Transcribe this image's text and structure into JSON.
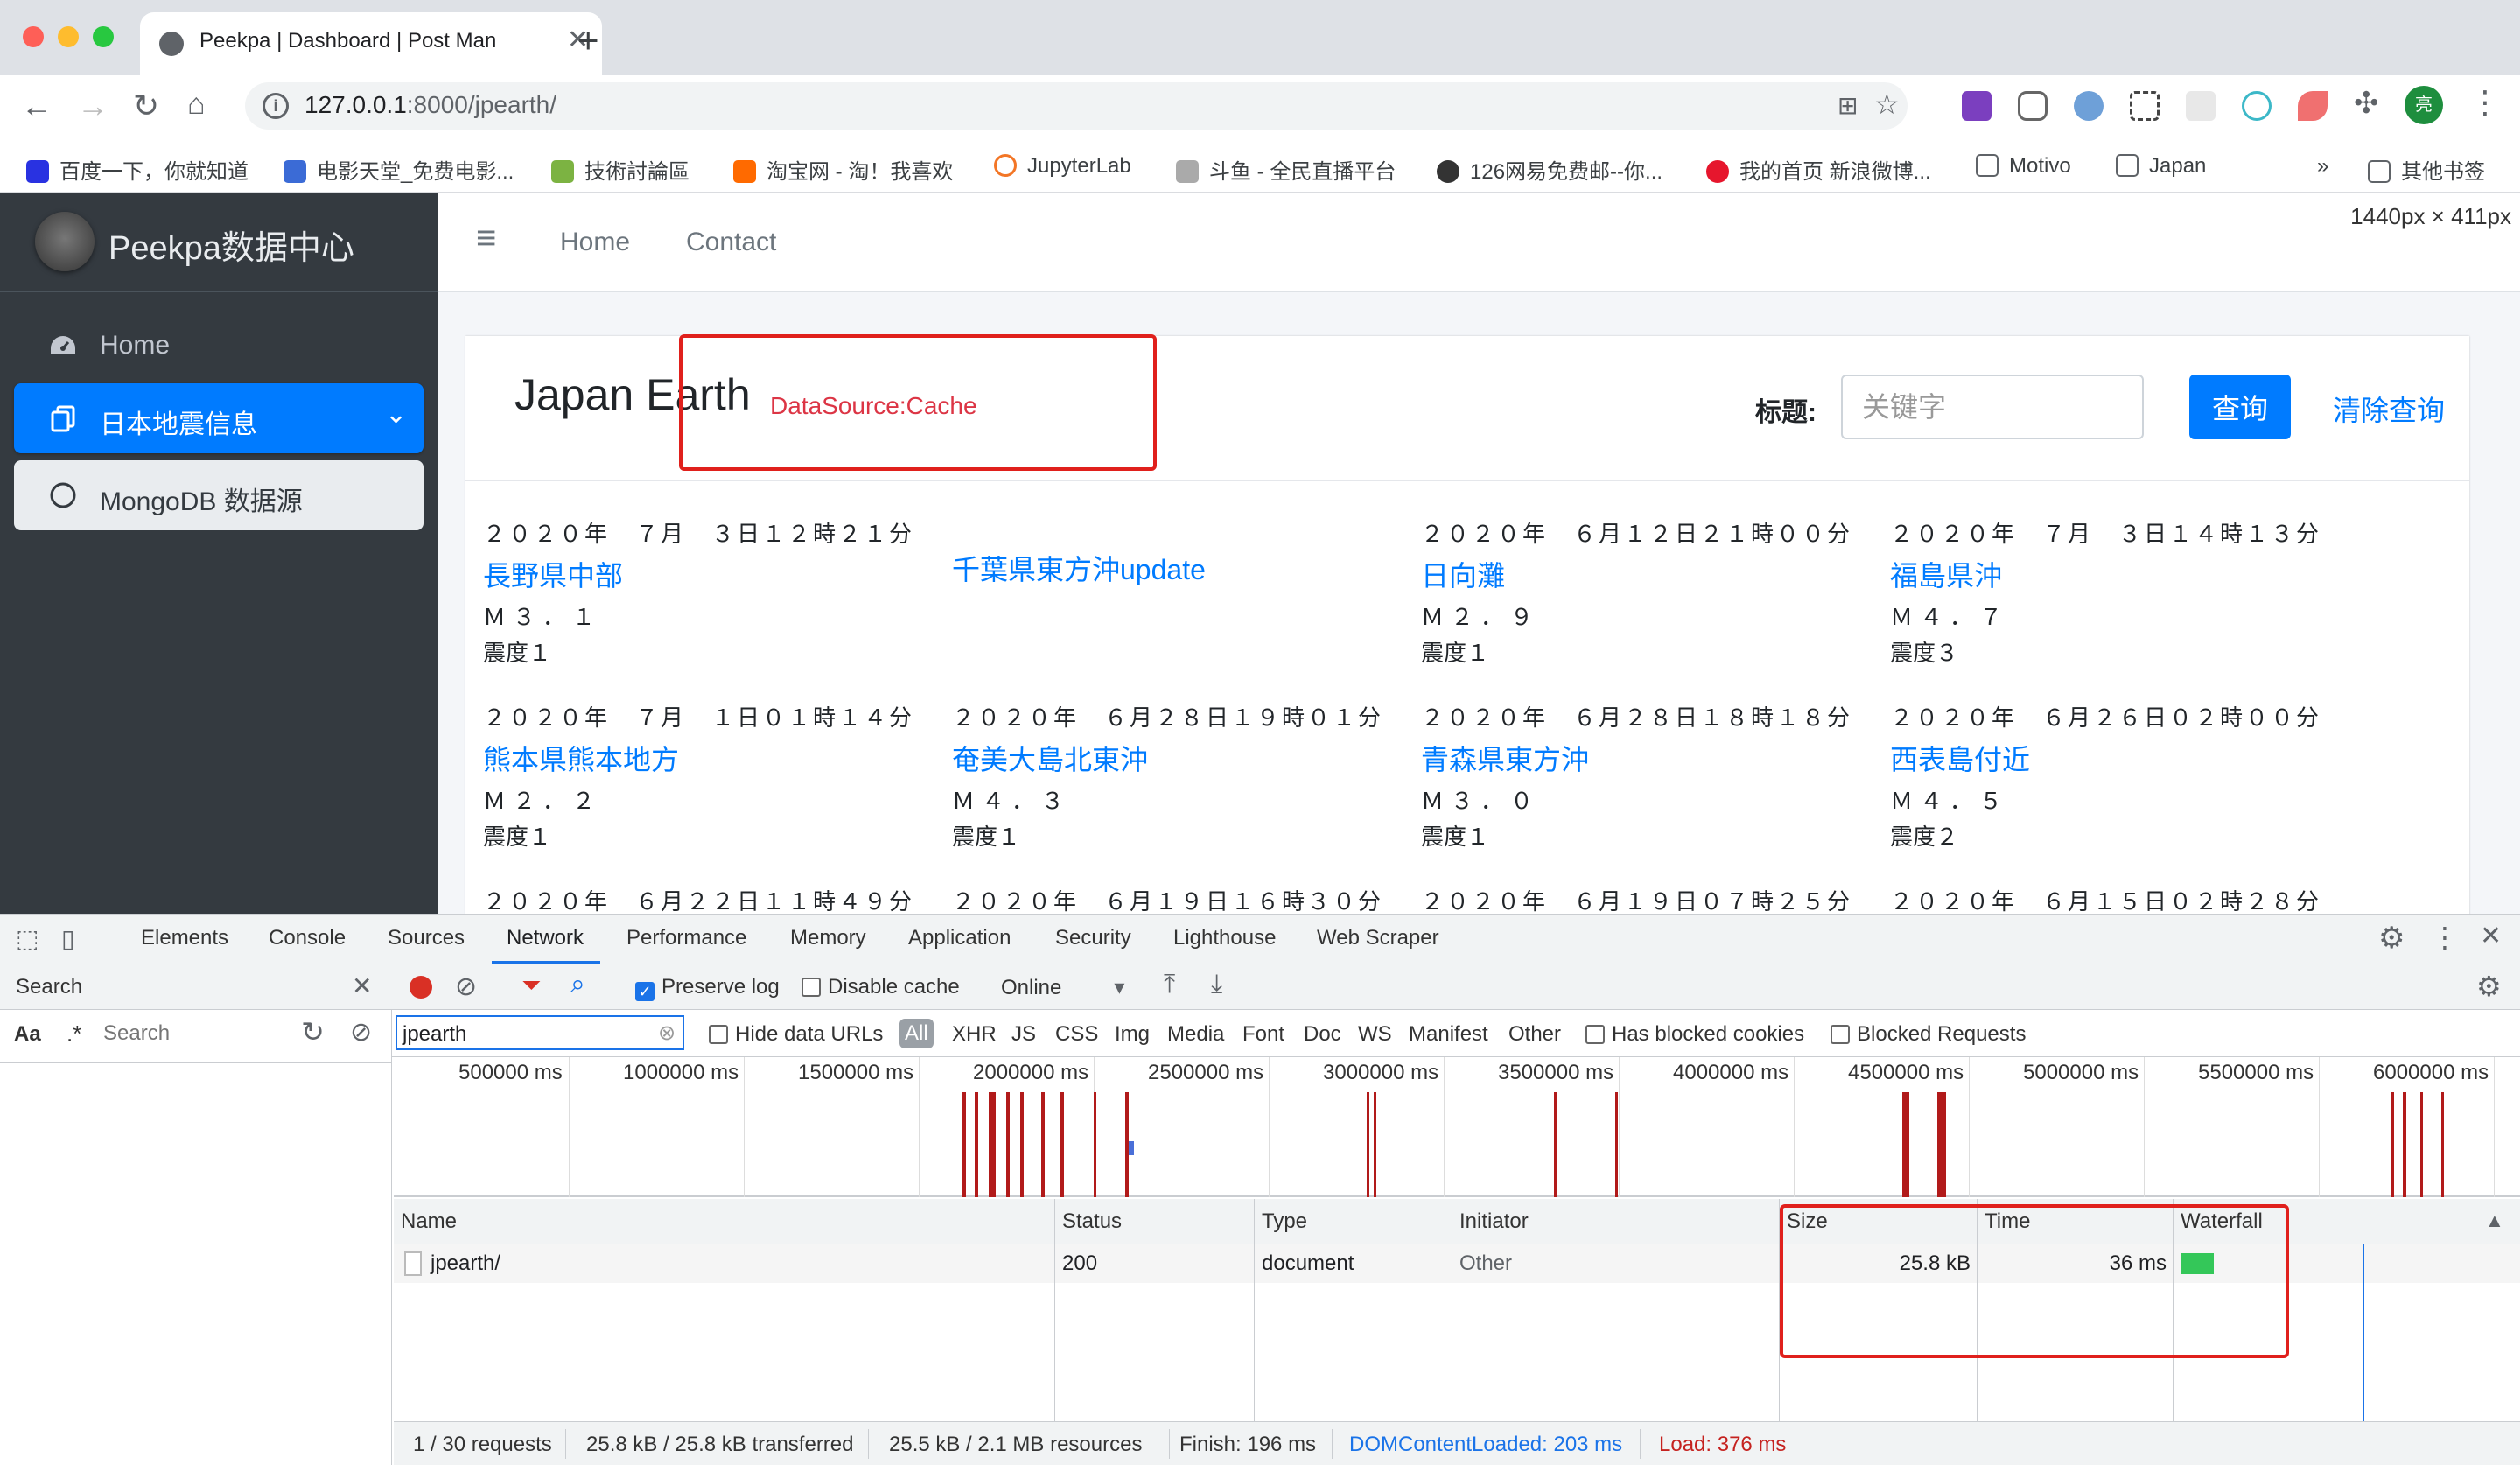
{
  "browser": {
    "tab_title": "Peekpa | Dashboard | Post Man",
    "url_host": "127.0.0.1",
    "url_rest": ":8000/jpearth/",
    "bookmarks": [
      "百度一下，你就知道",
      "电影天堂_免费电影...",
      "技術討論區",
      "淘宝网 - 淘！我喜欢",
      "JupyterLab",
      "斗鱼 - 全民直播平台",
      "126网易免费邮--你...",
      "我的首页 新浪微博...",
      "Motivo",
      "Japan",
      "»",
      "其他书签"
    ]
  },
  "sidebar": {
    "brand": "Peekpa数据中心",
    "items": [
      {
        "label": "Home"
      },
      {
        "label": "日本地震信息"
      },
      {
        "label": "MongoDB 数据源"
      }
    ]
  },
  "topnav": {
    "home": "Home",
    "contact": "Contact",
    "dims": "1440px × 411px"
  },
  "card": {
    "title": "Japan Earth",
    "datasource": "DataSource:Cache",
    "filter_label": "标题:",
    "filter_placeholder": "关键字",
    "search_btn": "查询",
    "clear_link": "清除查询"
  },
  "quakes": [
    {
      "time": "２０２０年　７月　３日１２時２１分",
      "loc": "長野県中部",
      "mag": "Ｍ３．１",
      "shindo": "震度１"
    },
    {
      "time": "",
      "loc": "千葉県東方沖update",
      "mag": "",
      "shindo": ""
    },
    {
      "time": "２０２０年　６月１２日２１時００分",
      "loc": "日向灘",
      "mag": "Ｍ２．９",
      "shindo": "震度１"
    },
    {
      "time": "２０２０年　７月　３日１４時１３分",
      "loc": "福島県沖",
      "mag": "Ｍ４．７",
      "shindo": "震度３"
    },
    {
      "time": "２０２０年　７月　１日０１時１４分",
      "loc": "熊本県熊本地方",
      "mag": "Ｍ２．２",
      "shindo": "震度１"
    },
    {
      "time": "２０２０年　６月２８日１９時０１分",
      "loc": "奄美大島北東沖",
      "mag": "Ｍ４．３",
      "shindo": "震度１"
    },
    {
      "time": "２０２０年　６月２８日１８時１８分",
      "loc": "青森県東方沖",
      "mag": "Ｍ３．０",
      "shindo": "震度１"
    },
    {
      "time": "２０２０年　６月２６日０２時００分",
      "loc": "西表島付近",
      "mag": "Ｍ４．５",
      "shindo": "震度２"
    },
    {
      "time": "２０２０年　６月２２日１１時４９分",
      "loc": "",
      "mag": "",
      "shindo": ""
    },
    {
      "time": "２０２０年　６月１９日１６時３０分",
      "loc": "",
      "mag": "",
      "shindo": ""
    },
    {
      "time": "２０２０年　６月１９日０７時２５分",
      "loc": "",
      "mag": "",
      "shindo": ""
    },
    {
      "time": "２０２０年　６月１５日０２時２８分",
      "loc": "",
      "mag": "",
      "shindo": ""
    }
  ],
  "devtools": {
    "tabs": [
      "Elements",
      "Console",
      "Sources",
      "Network",
      "Performance",
      "Memory",
      "Application",
      "Security",
      "Lighthouse",
      "Web Scraper"
    ],
    "search_title": "Search",
    "search_aa": "Aa",
    "search_regex": ".*",
    "search_placeholder": "Search",
    "preserve_log": "Preserve log",
    "disable_cache": "Disable cache",
    "throttle": "Online",
    "filter_value": "jpearth",
    "hide_data_urls": "Hide data URLs",
    "types": [
      "All",
      "XHR",
      "JS",
      "CSS",
      "Img",
      "Media",
      "Font",
      "Doc",
      "WS",
      "Manifest",
      "Other"
    ],
    "has_blocked": "Has blocked cookies",
    "blocked_requests": "Blocked Requests",
    "timeline_labels": [
      "500000 ms",
      "1000000 ms",
      "1500000 ms",
      "2000000 ms",
      "2500000 ms",
      "3000000 ms",
      "3500000 ms",
      "4000000 ms",
      "4500000 ms",
      "5000000 ms",
      "5500000 ms",
      "6000000 ms"
    ],
    "columns": [
      "Name",
      "Status",
      "Type",
      "Initiator",
      "Size",
      "Time",
      "Waterfall"
    ],
    "row": {
      "name": "jpearth/",
      "status": "200",
      "type": "document",
      "initiator": "Other",
      "size": "25.8 kB",
      "time": "36 ms"
    },
    "status": {
      "requests": "1 / 30 requests",
      "transferred": "25.8 kB / 25.8 kB transferred",
      "resources": "25.5 kB / 2.1 MB resources",
      "finish": "Finish: 196 ms",
      "dcl": "DOMContentLoaded: 203 ms",
      "load": "Load: 376 ms"
    }
  },
  "colors": {
    "accent": "#007bff",
    "sidebar": "#343a40",
    "highlight_red": "#e0201c",
    "dcl": "#1a73e8",
    "load": "#c5221f"
  }
}
